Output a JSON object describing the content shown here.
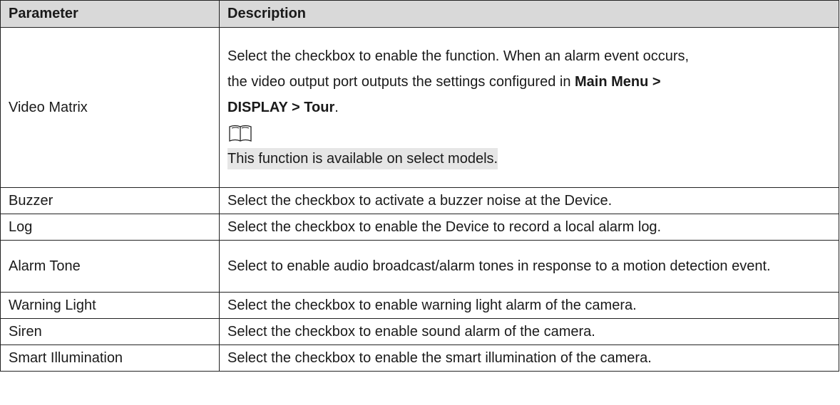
{
  "header": {
    "parameter": "Parameter",
    "description": "Description"
  },
  "rows": [
    {
      "param": "Video Matrix",
      "line1": "Select the checkbox to enable the function. When an alarm event occurs,",
      "line2_pre": "the video output port outputs the settings configured in ",
      "line2_bold": "Main Menu >",
      "line3_bold": "DISPLAY > Tour",
      "line3_post": ".",
      "note_icon": "book-icon",
      "note": "This function is available on select models."
    },
    {
      "param": "Buzzer",
      "desc": "Select the checkbox to activate a buzzer noise at the Device."
    },
    {
      "param": "Log",
      "desc": "Select the checkbox to enable the Device to record a local alarm log."
    },
    {
      "param": "Alarm Tone",
      "desc": "Select to enable audio broadcast/alarm tones in response to a motion detection event."
    },
    {
      "param": "Warning Light",
      "desc": "Select the checkbox to enable warning light alarm of the camera."
    },
    {
      "param": "Siren",
      "desc": "Select the checkbox to enable sound alarm of the camera."
    },
    {
      "param": "Smart Illumination",
      "desc": "Select the checkbox to enable the smart illumination of the camera."
    }
  ]
}
